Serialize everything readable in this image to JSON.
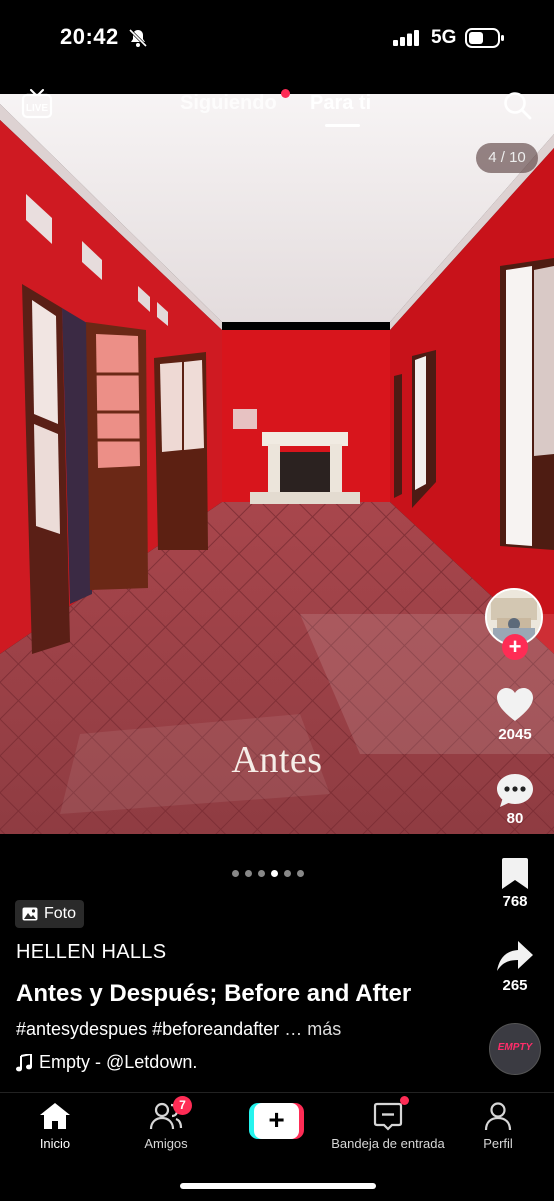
{
  "status_bar": {
    "time": "20:42",
    "network": "5G"
  },
  "top_nav": {
    "live_label": "LIVE",
    "tabs": [
      {
        "label": "Siguiendo",
        "has_dot": true
      },
      {
        "label": "Para ti",
        "active": true
      }
    ]
  },
  "post": {
    "photo_counter": "4 / 10",
    "photo_caption": "Antes",
    "carousel_dots": 6,
    "carousel_active_index": 3,
    "type_badge": "Foto",
    "author": "HELLEN HALLS",
    "title": "Antes y Después; Before and After",
    "hashtags": "#antesydespues #beforeandafter",
    "more_label": "… más",
    "music": "Empty - @Letdown."
  },
  "actions": {
    "likes": "2045",
    "comments": "80",
    "saves": "768",
    "shares": "265",
    "disc_label": "EMPTY"
  },
  "bottom_nav": {
    "items": [
      {
        "label": "Inicio",
        "icon": "home-icon",
        "active": true
      },
      {
        "label": "Amigos",
        "icon": "friends-icon",
        "badge": "7"
      },
      {
        "label": "",
        "icon": "create-icon"
      },
      {
        "label": "Bandeja de entrada",
        "icon": "inbox-icon",
        "has_dot": true
      },
      {
        "label": "Perfil",
        "icon": "profile-icon"
      }
    ]
  },
  "colors": {
    "accent": "#fe2c55",
    "cyan": "#25f4ee",
    "wall_red": "#d4141a"
  }
}
